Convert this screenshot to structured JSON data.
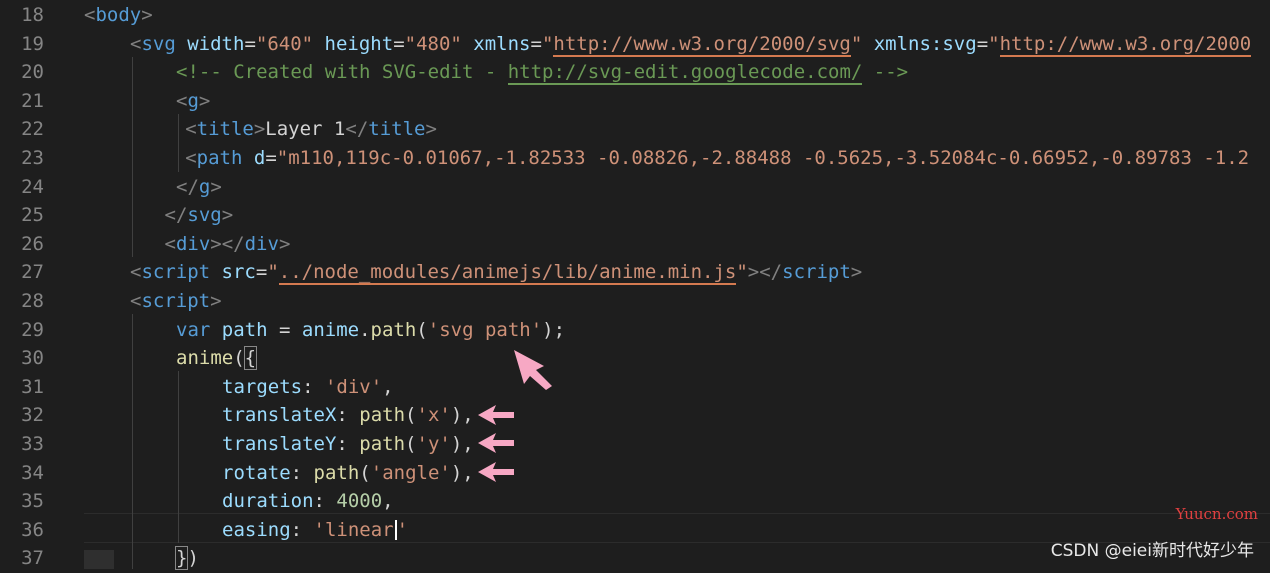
{
  "lines": [
    {
      "n": "18",
      "parts": [
        [
          "t",
          "<"
        ],
        [
          "tn",
          "body"
        ],
        [
          "t",
          ">"
        ]
      ],
      "indent": 0
    },
    {
      "n": "19",
      "parts": [
        [
          "t",
          "<"
        ],
        [
          "tn",
          "svg"
        ],
        [
          "pl",
          " "
        ],
        [
          "an",
          "width"
        ],
        [
          "pl",
          "="
        ],
        [
          "av",
          "\"640\""
        ],
        [
          "pl",
          " "
        ],
        [
          "an",
          "height"
        ],
        [
          "pl",
          "="
        ],
        [
          "av",
          "\"480\""
        ],
        [
          "pl",
          " "
        ],
        [
          "an",
          "xmlns"
        ],
        [
          "pl",
          "="
        ],
        [
          "av",
          "\""
        ],
        [
          "av_ul",
          "http://www.w3.org/2000/svg"
        ],
        [
          "av",
          "\""
        ],
        [
          "pl",
          " "
        ],
        [
          "an",
          "xmlns:svg"
        ],
        [
          "pl",
          "="
        ],
        [
          "av",
          "\""
        ],
        [
          "av_ul",
          "http://www.w3.org/2000"
        ]
      ],
      "indent": 1
    },
    {
      "n": "20",
      "parts": [
        [
          "cm",
          "<!-- Created with SVG-edit - "
        ],
        [
          "cm_ul",
          "http://svg-edit.googlecode.com/"
        ],
        [
          "cm",
          " -->"
        ]
      ],
      "indent": 2
    },
    {
      "n": "21",
      "parts": [
        [
          "t",
          "<"
        ],
        [
          "tn",
          "g"
        ],
        [
          "t",
          ">"
        ]
      ],
      "indent": 2
    },
    {
      "n": "22",
      "parts": [
        [
          "t",
          "<"
        ],
        [
          "tn",
          "title"
        ],
        [
          "t",
          ">"
        ],
        [
          "pl",
          "Layer 1"
        ],
        [
          "t",
          "</"
        ],
        [
          "tn",
          "title"
        ],
        [
          "t",
          ">"
        ]
      ],
      "indent": 2.2
    },
    {
      "n": "23",
      "parts": [
        [
          "t",
          "<"
        ],
        [
          "tn",
          "path"
        ],
        [
          "pl",
          " "
        ],
        [
          "an",
          "d"
        ],
        [
          "pl",
          "="
        ],
        [
          "av",
          "\"m110,119c-0.01067,-1.82533 -0.08826,-2.88488 -0.5625,-3.52084c-0.66952,-0.89783 -1.2"
        ]
      ],
      "indent": 2.2
    },
    {
      "n": "24",
      "parts": [
        [
          "t",
          "</"
        ],
        [
          "tn",
          "g"
        ],
        [
          "t",
          ">"
        ]
      ],
      "indent": 2
    },
    {
      "n": "25",
      "parts": [
        [
          "t",
          "</"
        ],
        [
          "tn",
          "svg"
        ],
        [
          "t",
          ">"
        ]
      ],
      "indent": 1.75
    },
    {
      "n": "26",
      "parts": [
        [
          "t",
          "<"
        ],
        [
          "tn",
          "div"
        ],
        [
          "t",
          "></"
        ],
        [
          "tn",
          "div"
        ],
        [
          "t",
          ">"
        ]
      ],
      "indent": 1.75
    },
    {
      "n": "27",
      "parts": [
        [
          "t",
          "<"
        ],
        [
          "tn",
          "script"
        ],
        [
          "pl",
          " "
        ],
        [
          "an",
          "src"
        ],
        [
          "pl",
          "="
        ],
        [
          "av",
          "\""
        ],
        [
          "av_ul",
          "../node_modules/animejs/lib/anime.min.js"
        ],
        [
          "av",
          "\""
        ],
        [
          "t",
          "></"
        ],
        [
          "tn",
          "script"
        ],
        [
          "t",
          ">"
        ]
      ],
      "indent": 1
    },
    {
      "n": "28",
      "parts": [
        [
          "t",
          "<"
        ],
        [
          "tn",
          "script"
        ],
        [
          "t",
          ">"
        ]
      ],
      "indent": 1
    },
    {
      "n": "29",
      "parts": [
        [
          "kw",
          "var"
        ],
        [
          "pl",
          " "
        ],
        [
          "vr",
          "path"
        ],
        [
          "pl",
          " = "
        ],
        [
          "vr",
          "anime"
        ],
        [
          "pl",
          "."
        ],
        [
          "fn",
          "path"
        ],
        [
          "pl",
          "("
        ],
        [
          "av",
          "'svg path'"
        ],
        [
          "pl",
          ");"
        ]
      ],
      "indent": 2
    },
    {
      "n": "30",
      "parts": [
        [
          "fn",
          "anime"
        ],
        [
          "pl",
          "("
        ],
        [
          "pl_hl",
          "{"
        ]
      ],
      "indent": 2
    },
    {
      "n": "31",
      "parts": [
        [
          "vr",
          "targets"
        ],
        [
          "pl",
          ": "
        ],
        [
          "av",
          "'div'"
        ],
        [
          "pl",
          ","
        ]
      ],
      "indent": 3
    },
    {
      "n": "32",
      "parts": [
        [
          "vr",
          "translateX"
        ],
        [
          "pl",
          ": "
        ],
        [
          "fn",
          "path"
        ],
        [
          "pl",
          "("
        ],
        [
          "av",
          "'x'"
        ],
        [
          "pl",
          "),"
        ]
      ],
      "indent": 3
    },
    {
      "n": "33",
      "parts": [
        [
          "vr",
          "translateY"
        ],
        [
          "pl",
          ": "
        ],
        [
          "fn",
          "path"
        ],
        [
          "pl",
          "("
        ],
        [
          "av",
          "'y'"
        ],
        [
          "pl",
          "),"
        ]
      ],
      "indent": 3
    },
    {
      "n": "34",
      "parts": [
        [
          "vr",
          "rotate"
        ],
        [
          "pl",
          ": "
        ],
        [
          "fn",
          "path"
        ],
        [
          "pl",
          "("
        ],
        [
          "av",
          "'angle'"
        ],
        [
          "pl",
          "),"
        ]
      ],
      "indent": 3
    },
    {
      "n": "35",
      "parts": [
        [
          "vr",
          "duration"
        ],
        [
          "pl",
          ": "
        ],
        [
          "num",
          "4000"
        ],
        [
          "pl",
          ","
        ]
      ],
      "indent": 3
    },
    {
      "n": "36",
      "parts": [
        [
          "vr",
          "easing"
        ],
        [
          "pl",
          ": "
        ],
        [
          "av",
          "'linear"
        ],
        [
          "caret",
          ""
        ],
        [
          "av",
          "'"
        ]
      ],
      "indent": 3
    },
    {
      "n": "37",
      "parts": [
        [
          "pl_hl",
          "}"
        ],
        [
          "pl",
          ")"
        ]
      ],
      "indent": 2
    }
  ],
  "watermarks": {
    "site": "Yuucn.com",
    "author": "CSDN @eiei新时代好少年"
  },
  "colors": {
    "background": "#1e1e1e",
    "arrow": "#f7a8c4",
    "yuucn": "#e04040"
  }
}
